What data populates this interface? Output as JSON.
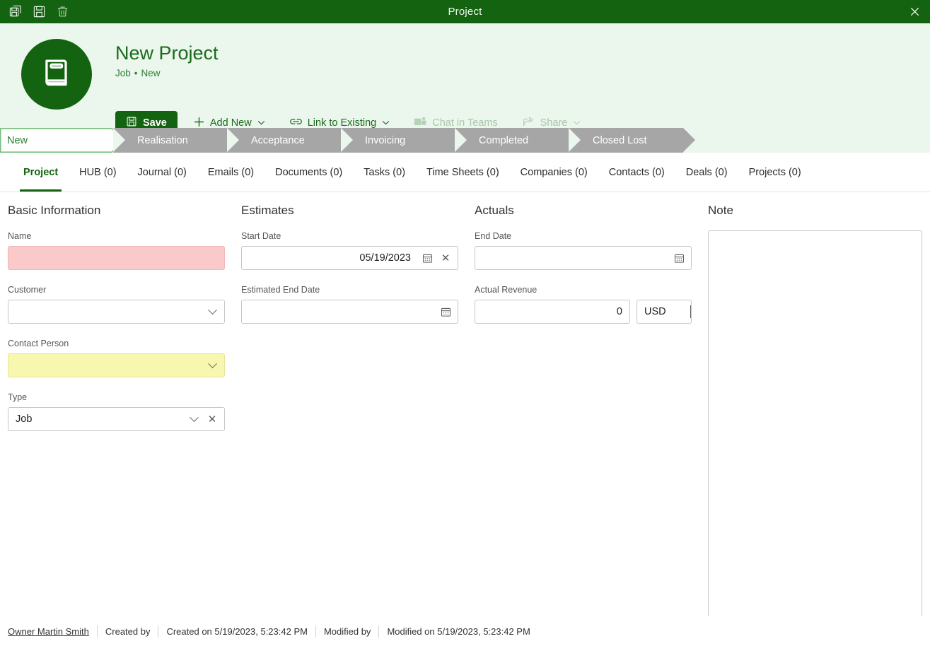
{
  "titlebar": {
    "title": "Project",
    "icons": [
      {
        "name": "save-as-icon",
        "glyph": "save-as"
      },
      {
        "name": "save-icon",
        "glyph": "save"
      },
      {
        "name": "delete-icon",
        "glyph": "trash"
      }
    ],
    "close_label": "✕",
    "background": "#136310"
  },
  "header": {
    "avatar_icon": "book-icon",
    "title": "New Project",
    "subtitle_type": "Job",
    "subtitle_separator": "•",
    "subtitle_status": "New",
    "accent": "#136310",
    "background": "#ebf6ec",
    "actions": {
      "save_label": "Save",
      "add_new_label": "Add New",
      "link_existing_label": "Link to Existing",
      "chat_teams_label": "Chat in Teams",
      "share_label": "Share",
      "chevron": "⌄"
    }
  },
  "stages": {
    "active_index": 0,
    "items": [
      {
        "label": "New",
        "state": "active"
      },
      {
        "label": "Realisation",
        "state": "inactive"
      },
      {
        "label": "Acceptance",
        "state": "inactive"
      },
      {
        "label": "Invoicing",
        "state": "inactive"
      },
      {
        "label": "Completed",
        "state": "inactive"
      },
      {
        "label": "Closed Lost",
        "state": "inactive"
      }
    ],
    "active_color": "#2e7d32",
    "inactive_color": "#a6a6a6"
  },
  "tabs": {
    "active_index": 0,
    "items": [
      {
        "label": "Project"
      },
      {
        "label": "HUB (0)"
      },
      {
        "label": "Journal (0)"
      },
      {
        "label": "Emails (0)"
      },
      {
        "label": "Documents (0)"
      },
      {
        "label": "Tasks (0)"
      },
      {
        "label": "Time Sheets (0)"
      },
      {
        "label": "Companies (0)"
      },
      {
        "label": "Contacts (0)"
      },
      {
        "label": "Deals (0)"
      },
      {
        "label": "Projects (0)"
      }
    ]
  },
  "basic_information": {
    "section_title": "Basic Information",
    "name": {
      "label": "Name",
      "value": "",
      "state": "error"
    },
    "customer": {
      "label": "Customer",
      "value": "",
      "state": "normal"
    },
    "contact_person": {
      "label": "Contact Person",
      "value": "",
      "state": "warning"
    },
    "type": {
      "label": "Type",
      "value": "Job",
      "state": "normal"
    }
  },
  "estimates": {
    "section_title": "Estimates",
    "start_date": {
      "label": "Start Date",
      "value": "05/19/2023"
    },
    "estimated_end_date": {
      "label": "Estimated End Date",
      "value": ""
    }
  },
  "actuals": {
    "section_title": "Actuals",
    "end_date": {
      "label": "End Date",
      "value": ""
    },
    "actual_revenue": {
      "label": "Actual Revenue",
      "value": "0",
      "currency": "USD"
    }
  },
  "note": {
    "section_title": "Note",
    "value": ""
  },
  "footer": {
    "owner": "Owner Martin Smith",
    "created_by_label": "Created by",
    "created_on": "Created on 5/19/2023, 5:23:42 PM",
    "modified_by_label": "Modified by",
    "modified_on": "Modified on 5/19/2023, 5:23:42 PM"
  }
}
